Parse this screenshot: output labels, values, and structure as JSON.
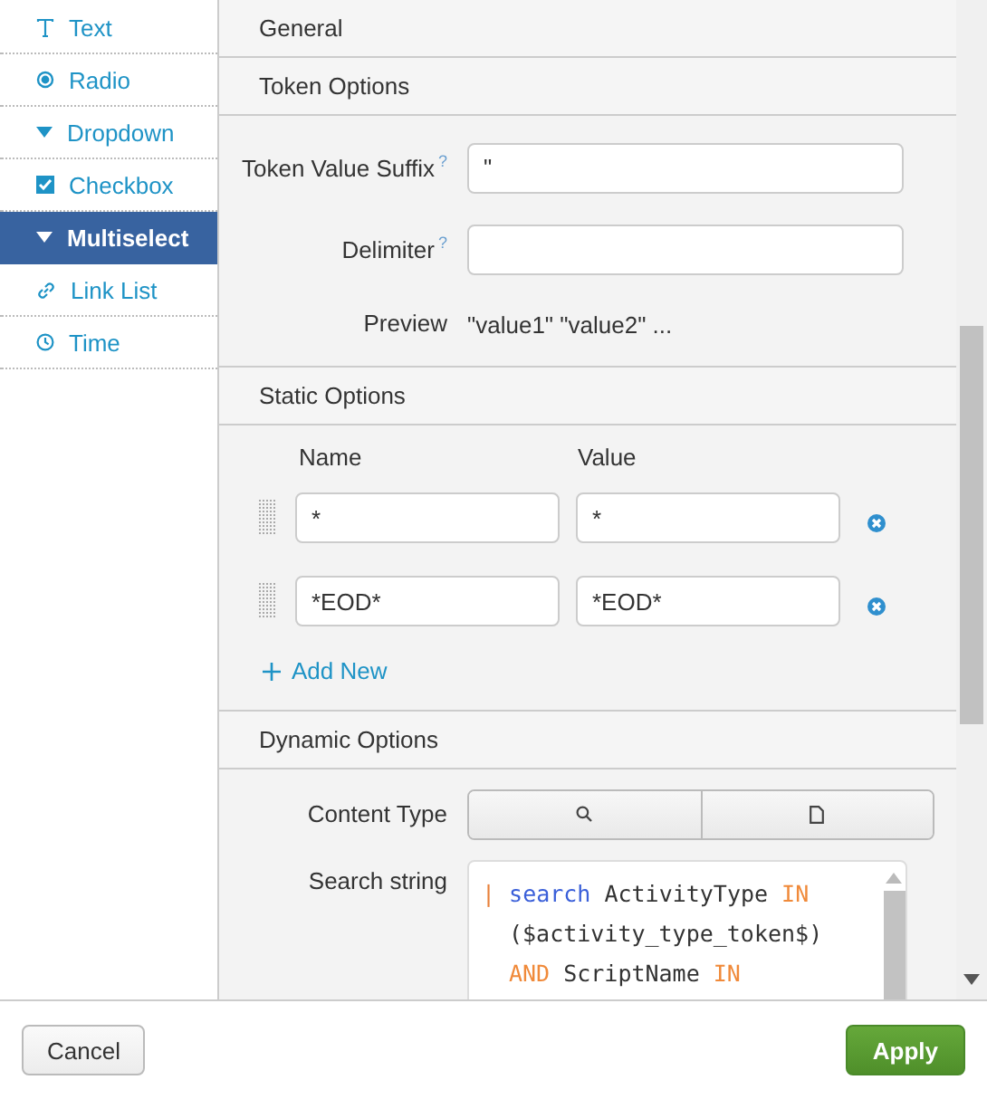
{
  "sidebar": {
    "items": [
      {
        "label": "Text",
        "kind": "text",
        "selected": false
      },
      {
        "label": "Radio",
        "kind": "radio",
        "selected": false
      },
      {
        "label": "Dropdown",
        "kind": "dropdown",
        "selected": false
      },
      {
        "label": "Checkbox",
        "kind": "checkbox",
        "selected": false
      },
      {
        "label": "Multiselect",
        "kind": "dropdown",
        "selected": true
      },
      {
        "label": "Link List",
        "kind": "link",
        "selected": false
      },
      {
        "label": "Time",
        "kind": "time",
        "selected": false
      }
    ]
  },
  "sections": {
    "general": "General",
    "token_options": "Token Options",
    "static_options": "Static Options",
    "dynamic_options": "Dynamic Options"
  },
  "token_fields": [
    {
      "label": "Token Value Suffix",
      "help": "?",
      "value": "\""
    },
    {
      "label": "Delimiter",
      "help": "?"
    }
  ],
  "preview": {
    "label": "Preview",
    "value": "\"value1\" \"value2\" ..."
  },
  "static_options": {
    "columns": [
      "Name",
      "Value"
    ],
    "rows": [
      {
        "name": "*",
        "value": "*"
      },
      {
        "name": "*EOD*",
        "value": "*EOD*"
      }
    ],
    "add_new": "Add New"
  },
  "dynamic": {
    "content_type_label": "Content Type",
    "search_label": "Search string",
    "code_lines": [
      {
        "continuation": false,
        "tokens": [
          {
            "text": "|",
            "kind": "pipe"
          },
          {
            "text": "search",
            "kind": "command"
          },
          {
            "text": "ActivityType",
            "kind": "plain"
          },
          {
            "text": "IN",
            "kind": "keyword"
          }
        ]
      },
      {
        "continuation": true,
        "tokens": [
          {
            "text": "($activity_type_token$)",
            "kind": "plain"
          }
        ]
      },
      {
        "continuation": true,
        "tokens": [
          {
            "text": "AND",
            "kind": "keyword"
          },
          {
            "text": "ScriptName",
            "kind": "plain"
          },
          {
            "text": "IN",
            "kind": "keyword"
          }
        ]
      }
    ]
  },
  "buttons": {
    "cancel": "Cancel",
    "apply": "Apply"
  }
}
